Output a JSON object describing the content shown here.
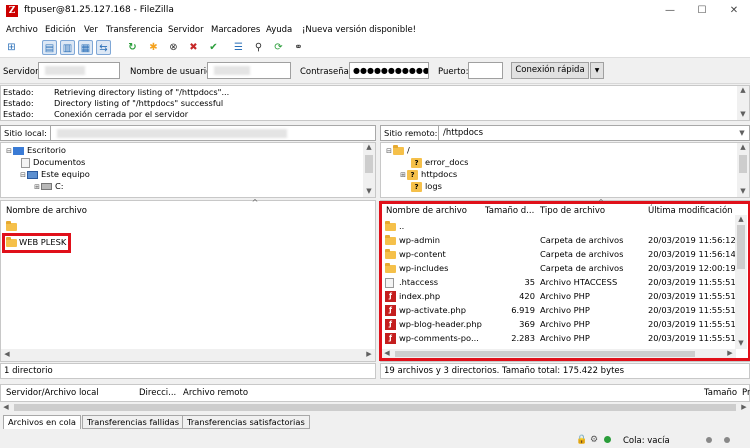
{
  "window": {
    "title": "ftpuser@81.25.127.168 - FileZilla",
    "app_icon": "Z"
  },
  "menu": [
    "Archivo",
    "Edición",
    "Ver",
    "Transferencia",
    "Servidor",
    "Marcadores",
    "Ayuda",
    "¡Nueva versión disponible!"
  ],
  "quickconnect": {
    "host_label": "Servidor:",
    "user_label": "Nombre de usuario:",
    "pass_label": "Contraseña:",
    "pass_value": "●●●●●●●●●●●●",
    "port_label": "Puerto:",
    "connect_label": "Conexión rápida",
    "dropdown_icon": "▼"
  },
  "log": [
    {
      "k": "Estado:",
      "v": "Retrieving directory listing of \"/httpdocs\"..."
    },
    {
      "k": "Estado:",
      "v": "Directory listing of \"/httpdocs\" successful"
    },
    {
      "k": "Estado:",
      "v": "Conexión cerrada por el servidor"
    }
  ],
  "local": {
    "site_label": "Sitio local:",
    "tree": [
      "Escritorio",
      "Documentos",
      "Este equipo",
      "C:"
    ],
    "col_name": "Nombre de archivo",
    "files": [
      "..",
      "WEB PLESK"
    ],
    "status": "1 directorio"
  },
  "remote": {
    "site_label": "Sitio remoto:",
    "path": "/httpdocs",
    "tree": [
      "/",
      "error_docs",
      "httpdocs",
      "logs"
    ],
    "columns": [
      "Nombre de archivo",
      "Tamaño d...",
      "Tipo de archivo",
      "Última modificación"
    ],
    "files": [
      {
        "name": "..",
        "size": "",
        "type": "",
        "date": ""
      },
      {
        "name": "wp-admin",
        "size": "",
        "type": "Carpeta de archivos",
        "date": "20/03/2019 11:56:12"
      },
      {
        "name": "wp-content",
        "size": "",
        "type": "Carpeta de archivos",
        "date": "20/03/2019 11:56:14"
      },
      {
        "name": "wp-includes",
        "size": "",
        "type": "Carpeta de archivos",
        "date": "20/03/2019 12:00:19"
      },
      {
        "name": ".htaccess",
        "size": "35",
        "type": "Archivo HTACCESS",
        "date": "20/03/2019 11:55:51"
      },
      {
        "name": "index.php",
        "size": "420",
        "type": "Archivo PHP",
        "date": "20/03/2019 11:55:51"
      },
      {
        "name": "wp-activate.php",
        "size": "6.919",
        "type": "Archivo PHP",
        "date": "20/03/2019 11:55:51"
      },
      {
        "name": "wp-blog-header.php",
        "size": "369",
        "type": "Archivo PHP",
        "date": "20/03/2019 11:55:51"
      },
      {
        "name": "wp-comments-po...",
        "size": "2.283",
        "type": "Archivo PHP",
        "date": "20/03/2019 11:55:51"
      }
    ],
    "status": "19 archivos y 3 directorios. Tamaño total: 175.422 bytes"
  },
  "queue": {
    "columns": [
      "Servidor/Archivo local",
      "Direcci...",
      "Archivo remoto",
      "Tamaño",
      "Pr"
    ],
    "tabs": [
      "Archivos en cola",
      "Transferencias fallidas",
      "Transferencias satisfactorias"
    ]
  },
  "footer": {
    "queue_status": "Cola: vacía"
  },
  "colors": {
    "highlight": "#e0101a",
    "folder": "#f5c04a"
  }
}
